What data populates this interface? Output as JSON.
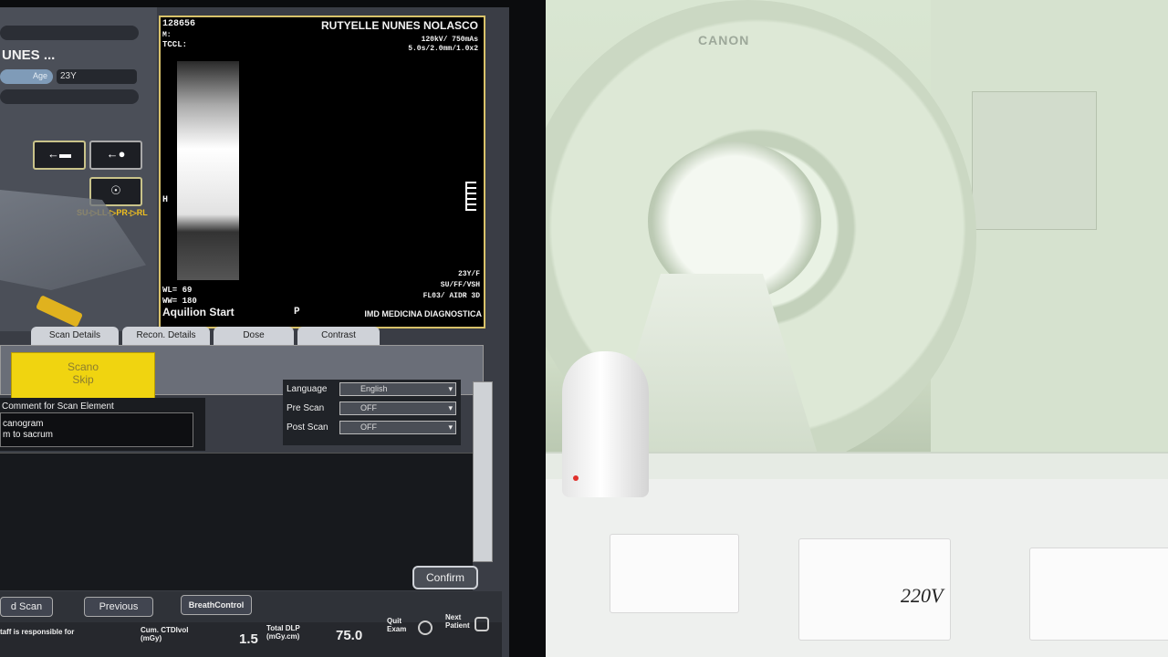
{
  "patient": {
    "id": "128656",
    "m_label": "M:",
    "tccl_label": "TCCL:",
    "name_short": "UNES ...",
    "age_label": "Age",
    "age": "23Y",
    "full_name": "RUTYELLE NUNES NOLASCO",
    "scan_params_1": "120kV/ 750mAs",
    "scan_params_2": "5.0s/2.0mm/1.0x2",
    "right_info_1": "23Y/F",
    "right_info_2": "SU/FF/VSH",
    "right_info_3": "FL03/ AIDR 3D",
    "institution": "IMD MEDICINA DIAGNOSTICA",
    "wl": "WL= 69",
    "ww": "WW= 180",
    "scanner": "Aquilion Start",
    "orientation_h": "H",
    "orientation_p": "P",
    "position_label": "SU-▷LL-▷PR-▷RL"
  },
  "tabs": [
    {
      "label": "Scan Details"
    },
    {
      "label": "Recon. Details"
    },
    {
      "label": "Dose"
    },
    {
      "label": "Contrast"
    }
  ],
  "scano_skip": {
    "line1": "Scano",
    "line2": "Skip"
  },
  "comment": {
    "title": "Comment for Scan Element",
    "line1": "canogram",
    "line2": "m to sacrum"
  },
  "settings": [
    {
      "label": "Language",
      "value": "English"
    },
    {
      "label": "Pre Scan",
      "value": "OFF"
    },
    {
      "label": "Post Scan",
      "value": "OFF"
    }
  ],
  "buttons": {
    "confirm": "Confirm",
    "add_scan": "d Scan",
    "previous": "Previous",
    "breath_control": "BreathControl",
    "quit_exam": "Quit Exam",
    "next_patient": "Next Patient"
  },
  "status": {
    "warning_line1": "taff is responsible for",
    "warning_line2": "",
    "ctdi_label": "Cum. CTDIvol (mGy)",
    "ctdi_value": "1.5",
    "dlp_label": "Total DLP (mGy.cm)",
    "dlp_value": "75.0"
  },
  "room": {
    "brand": "CANON",
    "gantry_model": "Aquilion",
    "voltage_label": "220V"
  }
}
